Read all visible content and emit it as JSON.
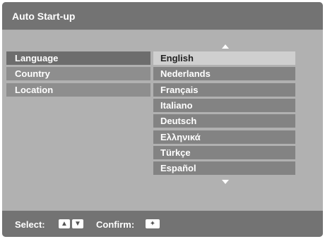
{
  "header": {
    "title": "Auto Start-up"
  },
  "menu": {
    "items": [
      {
        "label": "Language",
        "selected": true
      },
      {
        "label": "Country"
      },
      {
        "label": "Location"
      }
    ]
  },
  "languages": {
    "options": [
      {
        "label": "English",
        "selected": true
      },
      {
        "label": "Nederlands"
      },
      {
        "label": "Français"
      },
      {
        "label": "Italiano"
      },
      {
        "label": "Deutsch"
      },
      {
        "label": "Ελληνικά"
      },
      {
        "label": "Türkçe"
      },
      {
        "label": "Español"
      }
    ]
  },
  "footer": {
    "select_label": "Select:",
    "confirm_label": "Confirm:",
    "key_up_icon": "arrow-up-icon",
    "key_down_icon": "arrow-down-icon",
    "key_confirm_icon": "confirm-center-icon"
  },
  "colors": {
    "panel": "#ababab",
    "header": "#737373",
    "selected_option": "#cfcfcf"
  }
}
